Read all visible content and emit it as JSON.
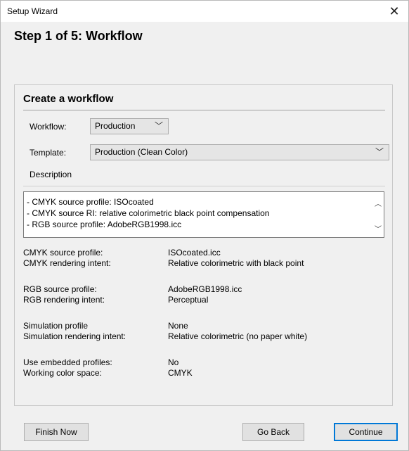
{
  "window": {
    "title": "Setup Wizard",
    "close_glyph": "✕"
  },
  "step_title": "Step 1 of 5: Workflow",
  "section": {
    "title": "Create a workflow",
    "workflow": {
      "label": "Workflow:",
      "value": "Production",
      "icon": "chevron-down-icon"
    },
    "template": {
      "label": "Template:",
      "value": "Production (Clean Color)",
      "icon": "chevron-down-icon"
    },
    "description": {
      "label": "Description",
      "lines": [
        "- CMYK source profile: ISOcoated",
        "- CMYK source RI: relative colorimetric black point compensation",
        "- RGB source profile: AdobeRGB1998.icc"
      ]
    },
    "properties": [
      {
        "label": "CMYK source profile:",
        "value": "ISOcoated.icc"
      },
      {
        "label": "CMYK rendering intent:",
        "value": "Relative colorimetric with black point"
      },
      {
        "label": "RGB source profile:",
        "value": "AdobeRGB1998.icc"
      },
      {
        "label": "RGB rendering intent:",
        "value": "Perceptual"
      },
      {
        "label": "Simulation profile",
        "value": "None"
      },
      {
        "label": "Simulation rendering intent:",
        "value": "Relative colorimetric (no paper white)"
      },
      {
        "label": "Use embedded profiles:",
        "value": "No"
      },
      {
        "label": "Working color space:",
        "value": "CMYK"
      }
    ]
  },
  "buttons": {
    "finish": "Finish Now",
    "back": "Go Back",
    "continue": "Continue"
  },
  "colors": {
    "accent": "#0078d7",
    "window_bg": "#f0f0f0"
  }
}
